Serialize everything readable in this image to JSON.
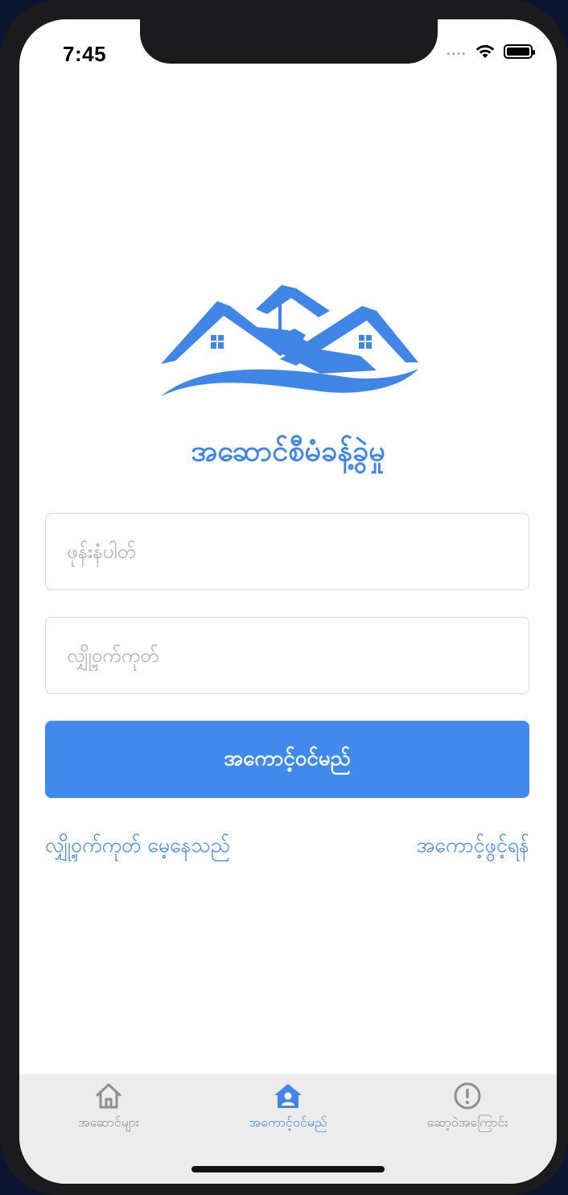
{
  "status_bar": {
    "time": "7:45",
    "signal": "....",
    "wifi_icon": "wifi-icon",
    "battery_icon": "battery-icon"
  },
  "app": {
    "logo_icon": "house-roof-logo-icon",
    "title": "အဆောင်စီမံခန့်ခွဲမှု",
    "brand_color": "#3F86E6"
  },
  "form": {
    "phone_placeholder": "ဖုန်းနံပါတ်",
    "phone_value": "",
    "password_placeholder": "လျှို့ဝှက်ကုတ်",
    "password_value": "",
    "login_label": "အကောင့်ဝင်မည်",
    "login_color": "#418AEC"
  },
  "links": {
    "forgot_password": "လျှို့ဝှက်ကုတ် မေ့နေသည်",
    "register": "အကောင့်ဖွင့်ရန်"
  },
  "tab_bar": {
    "tabs": [
      {
        "label": "အဆောင်များ",
        "icon": "home-icon",
        "active": false
      },
      {
        "label": "အကောင့်ဝင်မည်",
        "icon": "account-home-icon",
        "active": true
      },
      {
        "label": "ဆော့ဝဲအကြောင်း",
        "icon": "info-circle-icon",
        "active": false
      }
    ],
    "active_color": "#3F86E6",
    "inactive_color": "#8E8E8E"
  }
}
